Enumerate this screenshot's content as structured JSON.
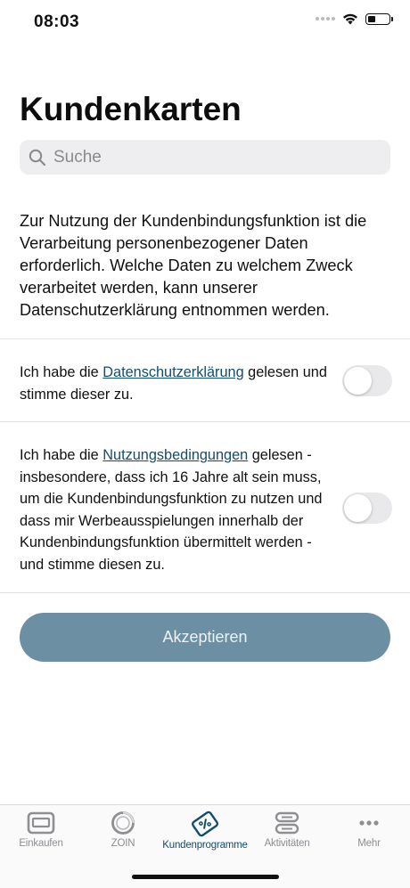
{
  "status": {
    "time": "08:03",
    "battery_level": 0.35
  },
  "header": {
    "title": "Kundenkarten"
  },
  "search": {
    "placeholder": "Suche",
    "icon": "search-icon"
  },
  "intro": {
    "text": "Zur Nutzung der Kundenbindungsfunktion ist die Verarbeitung personenbezogener Daten erforderlich. Welche Daten zu welchem Zweck verarbeitet werden, kann unserer Datenschutzerklärung entnommen werden."
  },
  "consents": [
    {
      "prefix": "Ich habe die ",
      "link": "Datenschutzerklärung",
      "suffix": " gelesen und stimme dieser zu.",
      "checked": false
    },
    {
      "prefix": "Ich habe die ",
      "link": "Nutzungsbedingungen",
      "suffix": " gelesen - insbesondere, dass ich 16 Jahre alt sein muss, um die Kundenbindungsfunktion zu nutzen und dass mir Werbeausspielungen innerhalb der Kundenbindungsfunktion übermittelt werden - und stimme diesen zu.",
      "checked": false
    }
  ],
  "accept_button": {
    "label": "Akzeptieren",
    "color": "#6d8fa4"
  },
  "tabbar": {
    "active_color": "#124d6e",
    "items": [
      {
        "label": "Einkaufen",
        "icon": "wallet-icon",
        "active": false
      },
      {
        "label": "ZOIN",
        "icon": "zoin-ring-icon",
        "active": false
      },
      {
        "label": "Kundenprogramme",
        "icon": "loyalty-card-icon",
        "active": true
      },
      {
        "label": "Aktivitäten",
        "icon": "activities-icon",
        "active": false
      },
      {
        "label": "Mehr",
        "icon": "more-dots-icon",
        "active": false
      }
    ]
  }
}
